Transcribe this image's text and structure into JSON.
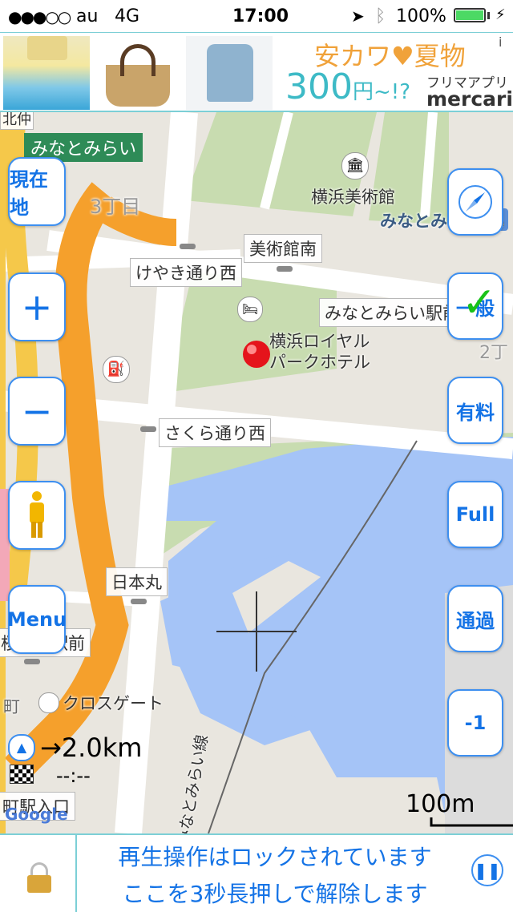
{
  "status_bar": {
    "signal": "●●●○○",
    "carrier": "au",
    "network": "4G",
    "time": "17:00",
    "battery": "100%"
  },
  "ad": {
    "line1": "安カワ♥夏物",
    "price": "300",
    "price_suffix": "円~!?",
    "app_label": "フリマアプリ",
    "brand": "mercari",
    "info": "i"
  },
  "map": {
    "district_label": "みなとみらい",
    "block_label_1": "3丁目",
    "block_label_2": "2丁",
    "museum": "横浜美術館",
    "minato_area": "みなとみら",
    "bijutsukan_minami": "美術館南",
    "keyaki_nishi": "けやき通り西",
    "mm_station": "みなとみらい駅前",
    "hotel_line1": "横浜ロイヤル",
    "hotel_line2": "パークホテル",
    "sakura_nishi": "さくら通り西",
    "nippon_maru": "日本丸",
    "station_front": "桜木町駅前",
    "cross_gate": "クロスゲート",
    "line_name": "みなとみらい線",
    "eki_iriguchi": "町駅入口",
    "machi": "町",
    "top_cut": "北仲",
    "distance": "→2.0km",
    "eta": "--:--",
    "scale": "100m",
    "google": "Google"
  },
  "buttons": {
    "current_location": "現在地",
    "zoom_in": "+",
    "zoom_out": "−",
    "menu": "Menu",
    "general": "一般",
    "toll": "有料",
    "full": "Full",
    "pass": "通過",
    "minus_one": "-1"
  },
  "lock_bar": {
    "line1": "再生操作はロックされています",
    "line2": "ここを3秒長押しで解除します"
  }
}
